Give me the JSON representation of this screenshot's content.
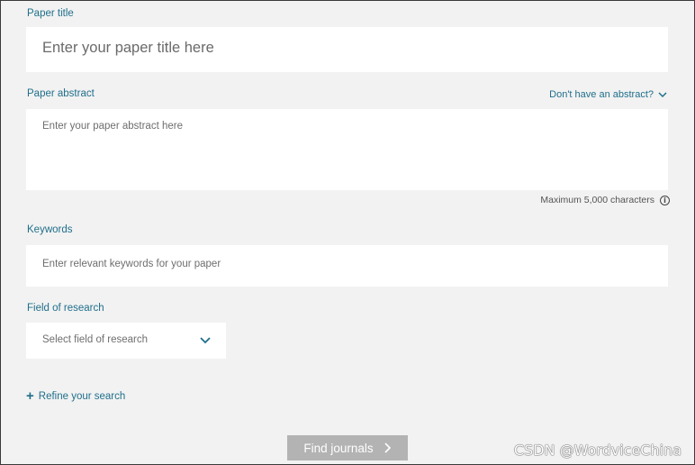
{
  "paper_title": {
    "label": "Paper title",
    "placeholder": "Enter your paper title here"
  },
  "paper_abstract": {
    "label": "Paper abstract",
    "placeholder": "Enter your paper abstract here",
    "dont_have_link": "Don't have an abstract?",
    "max_chars_note": "Maximum 5,000 characters"
  },
  "keywords": {
    "label": "Keywords",
    "placeholder": "Enter relevant keywords for your paper"
  },
  "field_of_research": {
    "label": "Field of research",
    "selected": "Select field of research"
  },
  "refine": {
    "label": "Refine your search"
  },
  "find_button": {
    "label": "Find journals"
  },
  "watermark": "CSDN @WordviceChina",
  "colors": {
    "accent": "#1f6f8b",
    "background": "#f2f2f2",
    "button_disabled": "#b3b3b3"
  }
}
